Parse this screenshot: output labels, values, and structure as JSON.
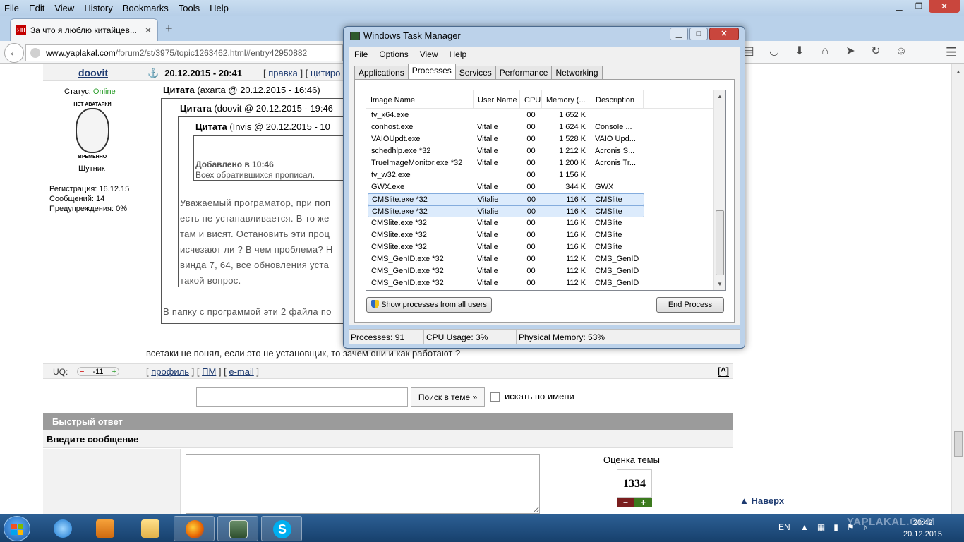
{
  "firefox": {
    "menu": [
      "File",
      "Edit",
      "View",
      "History",
      "Bookmarks",
      "Tools",
      "Help"
    ],
    "tab": {
      "favicon": "ЯП",
      "title": "За что я люблю китайцев..."
    },
    "url": {
      "domain": "www.yaplakal.com",
      "path": "/forum2/st/3975/topic1263462.html#entry42950882"
    }
  },
  "post": {
    "author": "doovit",
    "date": "20.12.2015 - 20:41",
    "links_prefix": "[",
    "link_edit": "правка",
    "links_mid": "] [",
    "link_quote": "цитиро",
    "status_label": "Статус:",
    "status_value": "Online",
    "avatar_top": "НЕТ АВАТАРКИ",
    "avatar_bottom": "ВРЕМЕННО",
    "rank": "Шутник",
    "reg": "Регистрация: 16.12.15",
    "messages": "Сообщений: 14",
    "warnings_label": "Предупреждения:",
    "warnings_value": "0%",
    "quote1": {
      "label": "Цитата",
      "meta": "(axarta @ 20.12.2015 - 16:46)"
    },
    "quote2": {
      "label": "Цитата",
      "meta": "(doovit @ 20.12.2015 - 19:46"
    },
    "quote3": {
      "label": "Цитата",
      "meta": "(Invis @ 20.12.2015 - 10"
    },
    "added_label": "Добавлено в 10:46",
    "added_text": "Всех обратившихся прописал.",
    "quote_text": [
      "Уважаемый програматор, при поп",
      "есть не устанавливается. В то же",
      "там и висят. Остановить эти проц",
      "исчезают ли ? В чем проблема? Н",
      "винда 7, 64, все обновления уста",
      "такой вопрос."
    ],
    "reply_partial": "В папку с программой эти 2 файла по",
    "reply_text": "всетаки не понял, если это не установщик, то зачем они и как работают ?"
  },
  "uq": {
    "label": "UQ:",
    "minus": "−",
    "value": "-11",
    "plus": "+",
    "link_profile": "профиль",
    "link_pm": "ПМ",
    "link_email": "e-mail",
    "up_label": "[^]"
  },
  "search": {
    "button": "Поиск в теме »",
    "checkbox_label": "искать по имени"
  },
  "quick_reply": {
    "title": "Быстрый ответ",
    "message_label": "Введите сообщение"
  },
  "rating": {
    "title": "Оценка темы",
    "value": "1334",
    "minus": "−",
    "plus": "+"
  },
  "to_top": "▲ Наверх",
  "taskmgr": {
    "title": "Windows Task Manager",
    "menu": [
      "File",
      "Options",
      "View",
      "Help"
    ],
    "tabs": [
      "Applications",
      "Processes",
      "Services",
      "Performance",
      "Networking"
    ],
    "columns": [
      "Image Name",
      "User Name",
      "CPU",
      "Memory (...",
      "Description"
    ],
    "rows": [
      {
        "name": "tv_x64.exe",
        "user": "",
        "cpu": "00",
        "mem": "1 652 K",
        "desc": ""
      },
      {
        "name": "conhost.exe",
        "user": "Vitalie",
        "cpu": "00",
        "mem": "1 624 K",
        "desc": "Console ..."
      },
      {
        "name": "VAIOUpdt.exe",
        "user": "Vitalie",
        "cpu": "00",
        "mem": "1 528 K",
        "desc": "VAIO Upd..."
      },
      {
        "name": "schedhlp.exe *32",
        "user": "Vitalie",
        "cpu": "00",
        "mem": "1 212 K",
        "desc": "Acronis S..."
      },
      {
        "name": "TrueImageMonitor.exe *32",
        "user": "Vitalie",
        "cpu": "00",
        "mem": "1 200 K",
        "desc": "Acronis Tr..."
      },
      {
        "name": "tv_w32.exe",
        "user": "",
        "cpu": "00",
        "mem": "1 156 K",
        "desc": ""
      },
      {
        "name": "GWX.exe",
        "user": "Vitalie",
        "cpu": "00",
        "mem": "344 K",
        "desc": "GWX"
      },
      {
        "name": "CMSlite.exe *32",
        "user": "Vitalie",
        "cpu": "00",
        "mem": "116 K",
        "desc": "CMSlite"
      },
      {
        "name": "CMSlite.exe *32",
        "user": "Vitalie",
        "cpu": "00",
        "mem": "116 K",
        "desc": "CMSlite"
      },
      {
        "name": "CMSlite.exe *32",
        "user": "Vitalie",
        "cpu": "00",
        "mem": "116 K",
        "desc": "CMSlite"
      },
      {
        "name": "CMSlite.exe *32",
        "user": "Vitalie",
        "cpu": "00",
        "mem": "116 K",
        "desc": "CMSlite"
      },
      {
        "name": "CMSlite.exe *32",
        "user": "Vitalie",
        "cpu": "00",
        "mem": "116 K",
        "desc": "CMSlite"
      },
      {
        "name": "CMS_GenID.exe *32",
        "user": "Vitalie",
        "cpu": "00",
        "mem": "112 K",
        "desc": "CMS_GenID"
      },
      {
        "name": "CMS_GenID.exe *32",
        "user": "Vitalie",
        "cpu": "00",
        "mem": "112 K",
        "desc": "CMS_GenID"
      },
      {
        "name": "CMS_GenID.exe *32",
        "user": "Vitalie",
        "cpu": "00",
        "mem": "112 K",
        "desc": "CMS_GenID"
      }
    ],
    "show_all_btn": "Show processes from all users",
    "end_btn": "End Process",
    "status": {
      "processes": "Processes: 91",
      "cpu": "CPU Usage: 3%",
      "memory": "Physical Memory: 53%"
    }
  },
  "taskbar": {
    "lang": "EN",
    "time": "20:42",
    "date": "20.12.2015",
    "watermark": "YAPLAKAL.COM"
  },
  "colors": {
    "online": "#2a9d2a",
    "link": "#1d3a70",
    "selection": "#dcebfc"
  }
}
